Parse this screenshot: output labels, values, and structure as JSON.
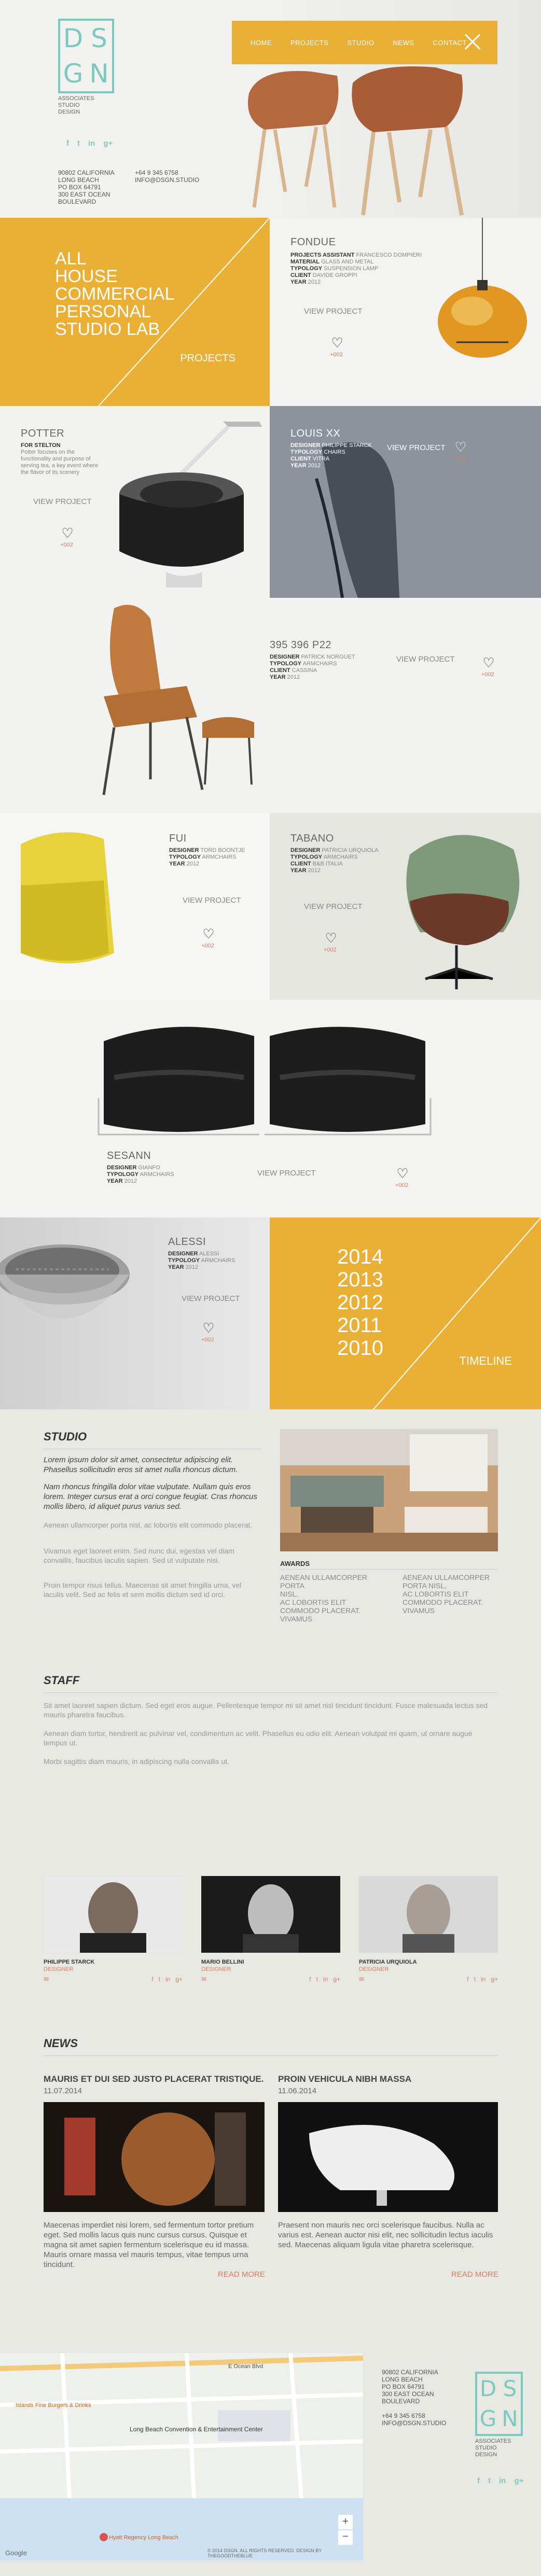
{
  "header": {
    "logo_letters": [
      "D",
      "S",
      "G",
      "N"
    ],
    "logo_sub": [
      "ASSOCIATES",
      "STUDIO",
      "DESIGN"
    ],
    "socials": [
      "f",
      "t",
      "in",
      "g+"
    ],
    "address": [
      "90802 CALIFORNIA",
      "LONG BEACH",
      "PO BOX 64791",
      "300 EAST OCEAN",
      "BOULEVARD"
    ],
    "contact": [
      "+64 9 345 6758",
      "INFO@DSGN.STUDIO"
    ],
    "nav": [
      "HOME",
      "PROJECTS",
      "STUDIO",
      "NEWS",
      "CONTACT"
    ]
  },
  "intro": {
    "lines": [
      "ALL",
      "HOUSE",
      "COMMERCIAL",
      "PERSONAL",
      "STUDIO LAB"
    ],
    "projects_label": "PROJECTS"
  },
  "products": {
    "fondue": {
      "name": "FONDUE",
      "meta": [
        [
          "PROJECTS ASSISTANT",
          "FRANCESCO DOMPIERI"
        ],
        [
          "MATERIAL",
          "GLASS AND METAL"
        ],
        [
          "TYPOLOGY",
          "SUSPENSION LAMP"
        ],
        [
          "CLIENT",
          "DAVIDE GROPPI"
        ],
        [
          "YEAR",
          "2012"
        ]
      ],
      "view": "VIEW PROJECT",
      "count": "+002"
    },
    "potter": {
      "name": "POTTER",
      "meta_label": "FOR STELTON",
      "desc": "Potter focuses on the functionality and purpose of serving tea, a key event where the flavor of its scenery",
      "view": "VIEW PROJECT",
      "count": "+002"
    },
    "louis": {
      "name": "LOUIS XX",
      "meta": [
        [
          "DESIGNER",
          "PHILIPPE STARCK"
        ],
        [
          "TYPOLOGY",
          "CHAIRS"
        ],
        [
          "CLIENT",
          "VITRA"
        ],
        [
          "YEAR",
          "2012"
        ]
      ],
      "view": "VIEW PROJECT",
      "count": "+002"
    },
    "p22": {
      "name": "395 396 P22",
      "meta": [
        [
          "DESIGNER",
          "PATRICK NORGUET"
        ],
        [
          "TYPOLOGY",
          "ARMCHAIRS"
        ],
        [
          "CLIENT",
          "CASSINA"
        ],
        [
          "YEAR",
          "2012"
        ]
      ],
      "view": "VIEW PROJECT",
      "count": "+002"
    },
    "fui": {
      "name": "FUI",
      "meta": [
        [
          "DESIGNER",
          "TORD BOONTJE"
        ],
        [
          "TYPOLOGY",
          "ARMCHAIRS"
        ],
        [
          "YEAR",
          "2012"
        ]
      ],
      "view": "VIEW PROJECT",
      "count": "+002"
    },
    "tabano": {
      "name": "TABANO",
      "meta": [
        [
          "DESIGNER",
          "PATRICIA URQUIOLA"
        ],
        [
          "TYPOLOGY",
          "ARMCHAIRS"
        ],
        [
          "CLIENT",
          "B&B ITALIA"
        ],
        [
          "YEAR",
          "2012"
        ]
      ],
      "view": "VIEW PROJECT",
      "count": "+002"
    },
    "sesann": {
      "name": "SESANN",
      "meta": [
        [
          "DESIGNER",
          "GIANFO"
        ],
        [
          "TYPOLOGY",
          "ARMCHAIRS"
        ],
        [
          "YEAR",
          "2012"
        ]
      ],
      "view": "VIEW PROJECT",
      "count": "+002"
    },
    "alessi": {
      "name": "ALESSI",
      "meta": [
        [
          "DESIGNER",
          "ALESSI"
        ],
        [
          "TYPOLOGY",
          "ARMCHAIRS"
        ],
        [
          "YEAR",
          "2012"
        ]
      ],
      "view": "VIEW PROJECT",
      "count": "+002"
    }
  },
  "timeline": {
    "years": [
      "2014",
      "2013",
      "2012",
      "2011",
      "2010"
    ],
    "label": "TIMELINE"
  },
  "studio": {
    "title": "STUDIO",
    "lead1": "Lorem ipsum dolor sit amet, consectetur adipiscing elit. Phasellus sollicitudin eros sit amet nulla rhoncus dictum.",
    "lead2": "Nam rhoncus fringilla dolor vitae vulputate. Nullam quis eros lorem. Integer cursus erat a orci congue feugiat. Cras rhoncus mollis libero, id aliquet purus varius sed.",
    "p1": "Aenean ullamcorper porta nisl, ac lobortis elit commodo placerat.",
    "p2": "Vivamus eget laoreet enim. Sed nunc dui, egestas vel diam convallis, faucibus iaculis sapien. Sed ut vulputate nisi.",
    "p3": "Proin tempor risus tellus. Maecenas sit amet fringilla urna, vel iaculis velit. Sed ac felis et sem mollis dictum sed id orci.",
    "awards_title": "AWARDS",
    "awards_left": [
      "AENEAN ULLAMCORPER",
      "PORTA",
      "NISL,",
      "AC LOBORTIS ELIT",
      "COMMODO PLACERAT.",
      "VIVAMUS"
    ],
    "awards_right": [
      "AENEAN ULLAMCORPER",
      "PORTA NISL,",
      "AC LOBORTIS ELIT",
      "COMMODO PLACERAT.",
      "VIVAMUS"
    ]
  },
  "staff": {
    "title": "STAFF",
    "p1": "Sit amet laoreet sapien dictum. Sed eget eros augue. Pellentesque tempor mi sit amet nisl tincidunt tincidunt. Fusce malesuada lectus sed mauris pharetra faucibus.",
    "p2": "Aenean diam tortor, hendrerit ac pulvinar vel, condimentum ac velit. Phasellus eu odio elit. Aenean volutpat mi quam, ut ornare augue tempus ut.",
    "p3": "Morbi sagittis diam mauris, in adipiscing nulla convallis ut.",
    "people": [
      {
        "name": "PHILIPPE STARCK",
        "role": "DESIGNER"
      },
      {
        "name": "MARIO BELLINI",
        "role": "DESIGNER"
      },
      {
        "name": "PATRICIA URQUIOLA",
        "role": "DESIGNER"
      }
    ],
    "social": [
      "f",
      "t",
      "in",
      "g+"
    ]
  },
  "news": {
    "title": "NEWS",
    "items": [
      {
        "title": "MAURIS ET DUI SED JUSTO PLACERAT TRISTIQUE.",
        "date": "11.07.2014",
        "text": "Maecenas imperdiet nisi lorem, sed fermentum tortor pretium eget. Sed mollis lacus quis nunc cursus cursus. Quisque et magna sit amet sapien fermentum scelerisque eu id massa. Mauris ornare massa vel mauris tempus, vitae tempus urna tincidunt.",
        "more": "READ MORE"
      },
      {
        "title": "PROIN VEHICULA NIBH MASSA",
        "date": "11.06.2014",
        "text": "Praesent non mauris nec orci scelerisque faucibus. Nulla ac varius est. Aenean auctor nisi elit, nec sollicitudin lectus iaculis sed. Maecenas aliquam ligula vitae pharetra scelerisque.",
        "more": "READ MORE"
      }
    ]
  },
  "footer": {
    "map_labels": [
      "Long Beach Convention & Entertainment Center",
      "E Ocean Blvd",
      "Islands Fine Burgers & Drinks",
      "Hyatt Regency Long Beach",
      "Google"
    ],
    "copyright": "© 2014 DSGN. ALL RIGHTS RESERVED. DESIGN BY THEGOODTHEBLUE",
    "address": [
      "90802 CALIFORNIA",
      "LONG BEACH",
      "PO BOX 64791",
      "300 EAST OCEAN",
      "BOULEVARD"
    ],
    "contact": [
      "+64 9 345 6758",
      "INFO@DSGN.STUDIO"
    ],
    "logo_sub": [
      "ASSOCIATES",
      "STUDIO",
      "DESIGN"
    ],
    "socials": [
      "f",
      "t",
      "in",
      "g+"
    ]
  },
  "colors": {
    "accent": "#e9b035",
    "teal": "#7ccabf",
    "coral": "#e07a5f"
  }
}
